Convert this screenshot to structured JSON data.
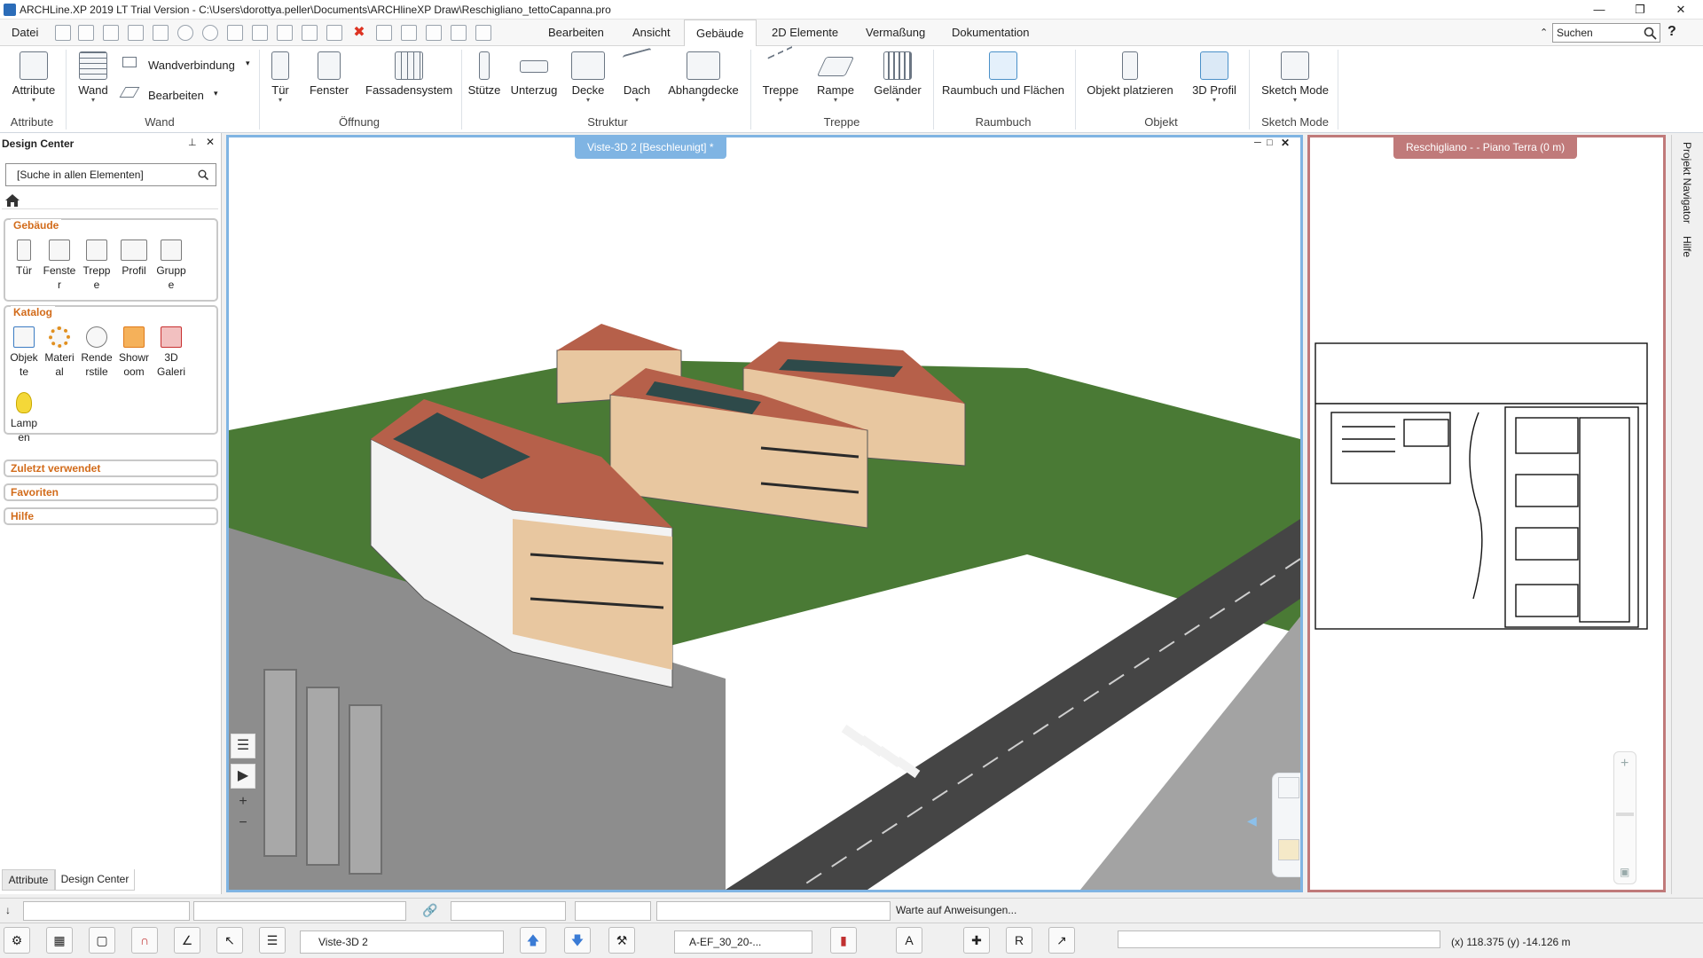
{
  "window": {
    "title": "ARCHLine.XP 2019  LT Trial Version - C:\\Users\\dorottya.peller\\Documents\\ARCHlineXP Draw\\Reschigliano_tettoCapanna.pro"
  },
  "menu": {
    "file": "Datei",
    "tabs": [
      "Bearbeiten",
      "Ansicht",
      "Gebäude",
      "2D Elemente",
      "Vermaßung",
      "Dokumentation"
    ],
    "active_tab": "Gebäude",
    "search_placeholder": "Suchen",
    "help_glyph": "?"
  },
  "ribbon": {
    "attribute_btn": "Attribute",
    "wand_btn": "Wand",
    "wandverbindung": "Wandverbindung",
    "bearbeiten": "Bearbeiten",
    "tuer": "Tür",
    "fenster": "Fenster",
    "fassade": "Fassadensystem",
    "stuetze": "Stütze",
    "unterzug": "Unterzug",
    "decke": "Decke",
    "dach": "Dach",
    "abhang": "Abhangdecke",
    "treppe": "Treppe",
    "rampe": "Rampe",
    "gelaender": "Geländer",
    "raumbuch": "Raumbuch und Flächen",
    "objekt": "Objekt platzieren",
    "profil3d": "3D Profil",
    "sketch": "Sketch Mode",
    "groups": {
      "attribute": "Attribute",
      "wand": "Wand",
      "oeffnung": "Öffnung",
      "struktur": "Struktur",
      "treppe": "Treppe",
      "raumbuch": "Raumbuch",
      "objekt": "Objekt",
      "sketch": "Sketch Mode"
    }
  },
  "design_center": {
    "title": "Design Center",
    "search": "[Suche in allen Elementen]",
    "gebaeude": "Gebäude",
    "gebaeude_items": [
      "Tür",
      "Fenste r",
      "Trepp e",
      "Profil",
      "Grupp e"
    ],
    "katalog": "Katalog",
    "katalog_items": [
      "Objek te",
      "Materi al",
      "Rende rstile",
      "Showr oom",
      "3D Galeri"
    ],
    "lamp": "Lamp en",
    "zuletzt": "Zuletzt verwendet",
    "favoriten": "Favoriten",
    "hilfe": "Hilfe",
    "bottom_tabs": [
      "Attribute",
      "Design Center"
    ]
  },
  "view3d": {
    "tab": "Viste-3D 2 [Beschleunigt] *"
  },
  "view2d": {
    "tab": "Reschigliano -  - Piano Terra (0 m)"
  },
  "right_rail": [
    "Projekt Navigator",
    "Hilfe"
  ],
  "status": {
    "message": "Warte auf Anweisungen...",
    "view_select": "Viste-3D 2",
    "layer_select": "A-EF_30_20-...",
    "coords": "(x) 118.375   (y) -14.126 m"
  },
  "colors": {
    "view3d_border": "#7fb4e3",
    "view2d_border": "#c07a7a",
    "catalog_label": "#d26b1a",
    "grass": "#4a7a35",
    "roof": "#b6604a",
    "facade": "#e8c7a0",
    "road": "#4b4b4b"
  }
}
